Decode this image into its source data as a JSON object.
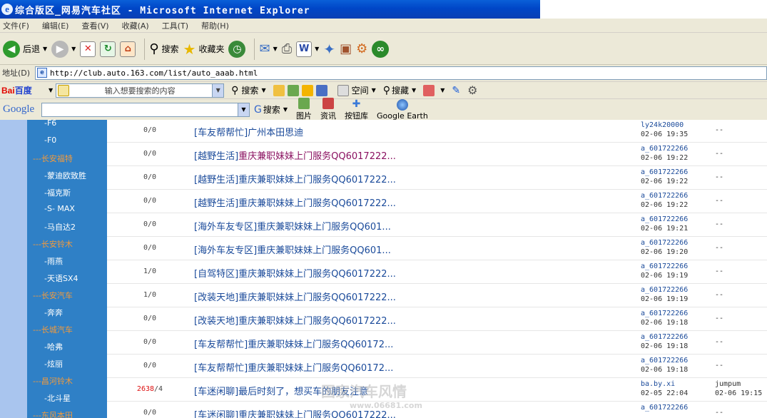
{
  "window": {
    "title": "综合版区_网易汽车社区 - Microsoft Internet Explorer"
  },
  "menu": [
    "文件(F)",
    "编辑(E)",
    "查看(V)",
    "收藏(A)",
    "工具(T)",
    "帮助(H)"
  ],
  "toolbar": {
    "back": "后退",
    "search": "搜索",
    "favorites": "收藏夹"
  },
  "address": {
    "label": "地址(D)",
    "url": "http://club.auto.163.com/list/auto_aaab.html"
  },
  "baidu": {
    "logo_a": "Bai",
    "logo_b": "百度",
    "placeholder": "输入想要搜索的内容",
    "search": "搜索",
    "space": "空间",
    "collect": "搜藏"
  },
  "google": {
    "logo": "Google",
    "search": "搜索",
    "images": "图片",
    "news": "资讯",
    "buttons": "按钮库",
    "earth": "Google Earth"
  },
  "sidebar": [
    {
      "label": "-F6",
      "cat": false
    },
    {
      "label": "-F0",
      "cat": false
    },
    {
      "label": "---长安福特",
      "cat": true
    },
    {
      "label": "-蒙迪欧致胜",
      "cat": false
    },
    {
      "label": "-福克斯",
      "cat": false
    },
    {
      "label": "-S- MAX",
      "cat": false
    },
    {
      "label": "-马自达2",
      "cat": false
    },
    {
      "label": "---长安铃木",
      "cat": true
    },
    {
      "label": "-雨燕",
      "cat": false
    },
    {
      "label": "-天语SX4",
      "cat": false
    },
    {
      "label": "---长安汽车",
      "cat": true
    },
    {
      "label": "-奔奔",
      "cat": false
    },
    {
      "label": "---长城汽车",
      "cat": true
    },
    {
      "label": "-哈弗",
      "cat": false
    },
    {
      "label": "-炫丽",
      "cat": false
    },
    {
      "label": "---昌河铃木",
      "cat": true
    },
    {
      "label": "-北斗星",
      "cat": false
    },
    {
      "label": "---东风本田",
      "cat": true
    }
  ],
  "rows": [
    {
      "count_a": "0",
      "count_b": "0",
      "hot": false,
      "tag": "[车友帮帮忙]",
      "title": "广州本田思迪",
      "pink": false,
      "author": "ly24k20000",
      "date": "02-06 19:35",
      "last": "--",
      "last2": ""
    },
    {
      "count_a": "0",
      "count_b": "0",
      "hot": false,
      "tag": "[越野生活]",
      "title": "重庆兼职妹妹上门服务QQ6017222...",
      "pink": true,
      "author": "a_601722266",
      "date": "02-06 19:22",
      "last": "--",
      "last2": ""
    },
    {
      "count_a": "0",
      "count_b": "0",
      "hot": false,
      "tag": "[越野生活]",
      "title": "重庆兼职妹妹上门服务QQ6017222...",
      "pink": false,
      "author": "a_601722266",
      "date": "02-06 19:22",
      "last": "--",
      "last2": ""
    },
    {
      "count_a": "0",
      "count_b": "0",
      "hot": false,
      "tag": "[越野生活]",
      "title": "重庆兼职妹妹上门服务QQ6017222...",
      "pink": false,
      "author": "a_601722266",
      "date": "02-06 19:22",
      "last": "--",
      "last2": ""
    },
    {
      "count_a": "0",
      "count_b": "0",
      "hot": false,
      "tag": "[海外车友专区]",
      "title": "重庆兼职妹妹上门服务QQ601...",
      "pink": false,
      "author": "a_601722266",
      "date": "02-06 19:21",
      "last": "--",
      "last2": ""
    },
    {
      "count_a": "0",
      "count_b": "0",
      "hot": false,
      "tag": "[海外车友专区]",
      "title": "重庆兼职妹妹上门服务QQ601...",
      "pink": false,
      "author": "a_601722266",
      "date": "02-06 19:20",
      "last": "--",
      "last2": ""
    },
    {
      "count_a": "1",
      "count_b": "0",
      "hot": false,
      "tag": "[自驾特区]",
      "title": "重庆兼职妹妹上门服务QQ6017222...",
      "pink": false,
      "author": "a_601722266",
      "date": "02-06 19:19",
      "last": "--",
      "last2": ""
    },
    {
      "count_a": "1",
      "count_b": "0",
      "hot": false,
      "tag": "[改装天地]",
      "title": "重庆兼职妹妹上门服务QQ6017222...",
      "pink": false,
      "author": "a_601722266",
      "date": "02-06 19:19",
      "last": "--",
      "last2": ""
    },
    {
      "count_a": "0",
      "count_b": "0",
      "hot": false,
      "tag": "[改装天地]",
      "title": "重庆兼职妹妹上门服务QQ6017222...",
      "pink": false,
      "author": "a_601722266",
      "date": "02-06 19:18",
      "last": "--",
      "last2": ""
    },
    {
      "count_a": "0",
      "count_b": "0",
      "hot": false,
      "tag": "[车友帮帮忙]",
      "title": "重庆兼职妹妹上门服务QQ60172...",
      "pink": false,
      "author": "a_601722266",
      "date": "02-06 19:18",
      "last": "--",
      "last2": ""
    },
    {
      "count_a": "0",
      "count_b": "0",
      "hot": false,
      "tag": "[车友帮帮忙]",
      "title": "重庆兼职妹妹上门服务QQ60172...",
      "pink": false,
      "author": "a_601722266",
      "date": "02-06 19:18",
      "last": "--",
      "last2": ""
    },
    {
      "count_a": "2638",
      "count_b": "4",
      "hot": true,
      "tag": "[车迷闲聊]",
      "title": "最后时刻了，想买车的朋友注意",
      "pink": false,
      "author": "ba.by.xi",
      "date": "02-05 22:04",
      "last": "jumpum",
      "last2": "02-06 19:15"
    },
    {
      "count_a": "0",
      "count_b": "0",
      "hot": false,
      "tag": "[车迷闲聊]",
      "title": "重庆兼职妹妹上门服务QQ6017222...",
      "pink": false,
      "author": "a_601722266",
      "date": "",
      "last": "--",
      "last2": ""
    }
  ],
  "watermark": {
    "text": "国家汽车风情",
    "url": "www.06681.com"
  }
}
